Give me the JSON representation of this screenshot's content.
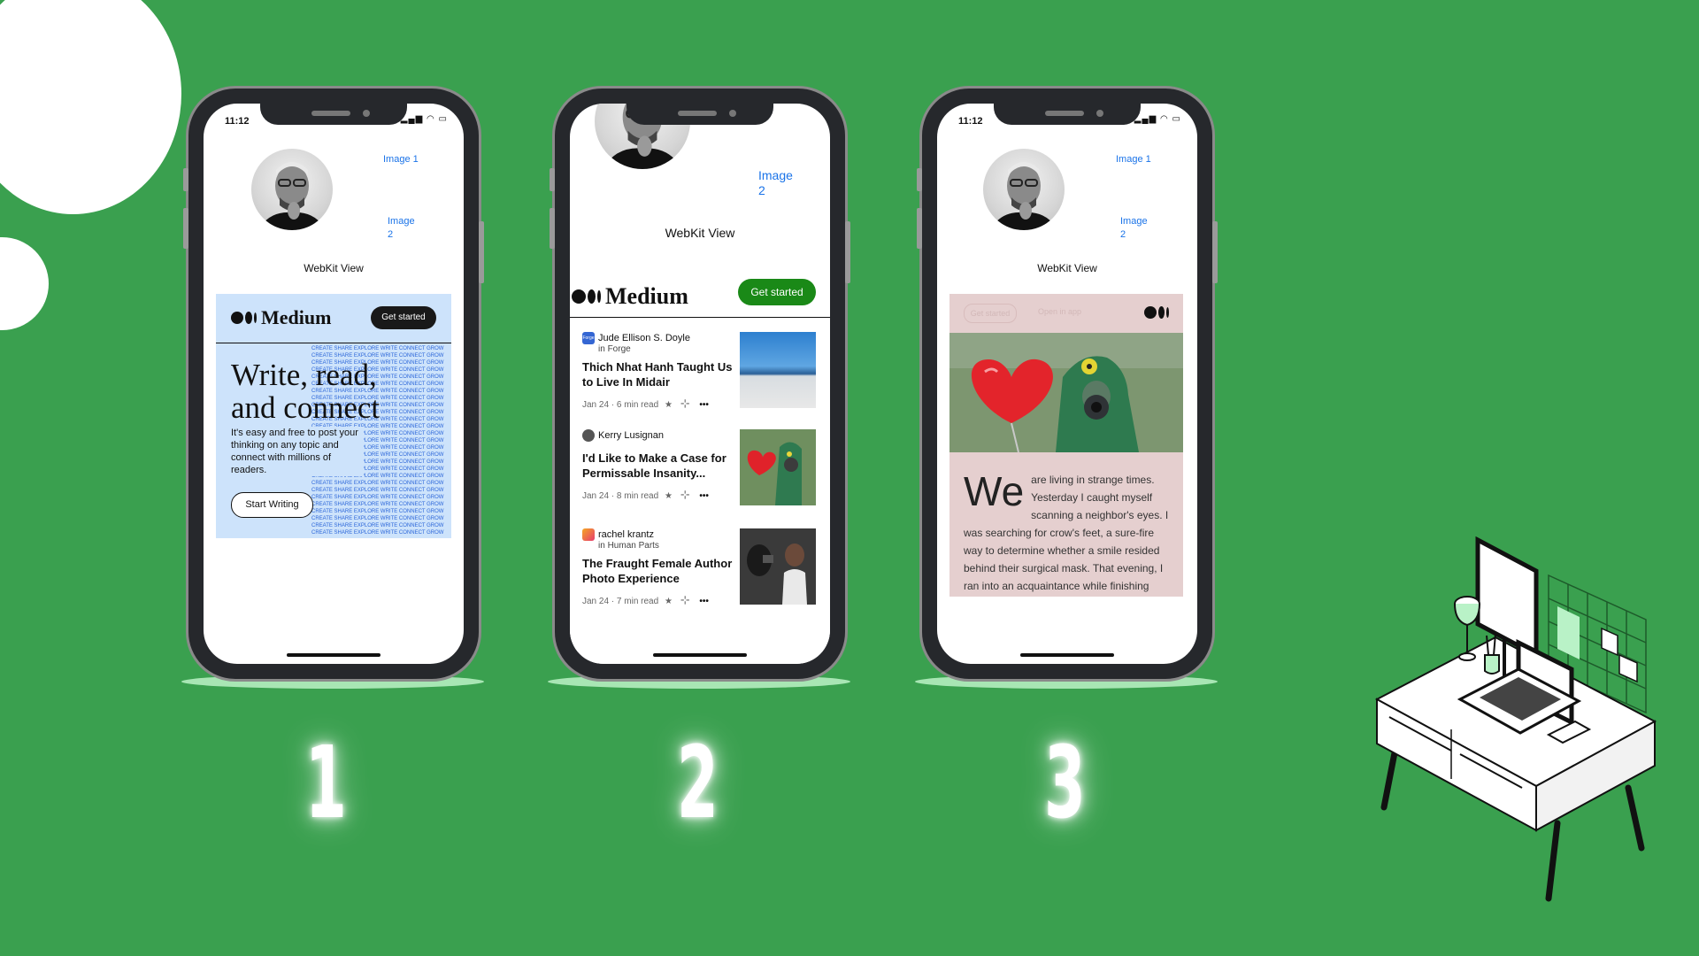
{
  "theme": {
    "background": "#3aa04f",
    "medium_green": "#1a8917",
    "link_blue": "#1a73e8",
    "hero_blue": "#cde3fb",
    "article_pink": "#e5cfcf"
  },
  "step_numbers": [
    "1",
    "2",
    "3"
  ],
  "phone1": {
    "status_time": "11:12",
    "link_image1": "Image 1",
    "link_image2_line1": "Image",
    "link_image2_line2": "2",
    "webkit_label": "WebKit View",
    "medium_logo": "Medium",
    "get_started": "Get started",
    "headline_line1": "Write, read,",
    "headline_line2": "and connect",
    "subtext": "It's easy and free to post your thinking on any topic and connect with millions of readers.",
    "start_writing": "Start Writing",
    "pattern_words": "CREATE SHARE EXPLORE WRITE CONNECT GROW"
  },
  "phone2": {
    "link_image2_line1": "Image",
    "link_image2_line2": "2",
    "webkit_label": "WebKit View",
    "medium_logo": "Medium",
    "get_started": "Get started",
    "articles": [
      {
        "author": "Jude Ellison S. Doyle",
        "in": "in",
        "publication": "Forge",
        "pub_icon_label": "Forge",
        "title": "Thich Nhat Hanh Taught Us to Live In Midair",
        "date": "Jan 24",
        "read": "6 min read",
        "thumb": "beach"
      },
      {
        "author": "Kerry Lusignan",
        "in": "",
        "publication": "",
        "title": "I'd Like to Make a Case for Permissable Insanity...",
        "date": "Jan 24",
        "read": "8 min read",
        "thumb": "heart-gasmask"
      },
      {
        "author": "rachel krantz",
        "in": "in",
        "publication": "Human Parts",
        "title": "The Fraught Female Author Photo Experience",
        "date": "Jan 24",
        "read": "7 min read",
        "thumb": "photographer"
      }
    ]
  },
  "phone3": {
    "status_time": "11:12",
    "link_image1": "Image 1",
    "link_image2_line1": "Image",
    "link_image2_line2": "2",
    "webkit_label": "WebKit View",
    "faded_get_started": "Get started",
    "faded_open_in_app": "Open in app",
    "dropcap": "We",
    "body_first": "are living in strange times. Yesterday I caught myself",
    "body_rest": "scanning a neighbor's eyes. I was searching for crow's feet, a sure-fire way to determine whether a smile resided behind their surgical mask. That evening, I ran into an acquaintance while finishing"
  },
  "icons": {
    "status": "signal-wifi-battery-icon",
    "star": "star-icon",
    "bookmark": "bookmark-add-icon",
    "more": "more-icon"
  }
}
